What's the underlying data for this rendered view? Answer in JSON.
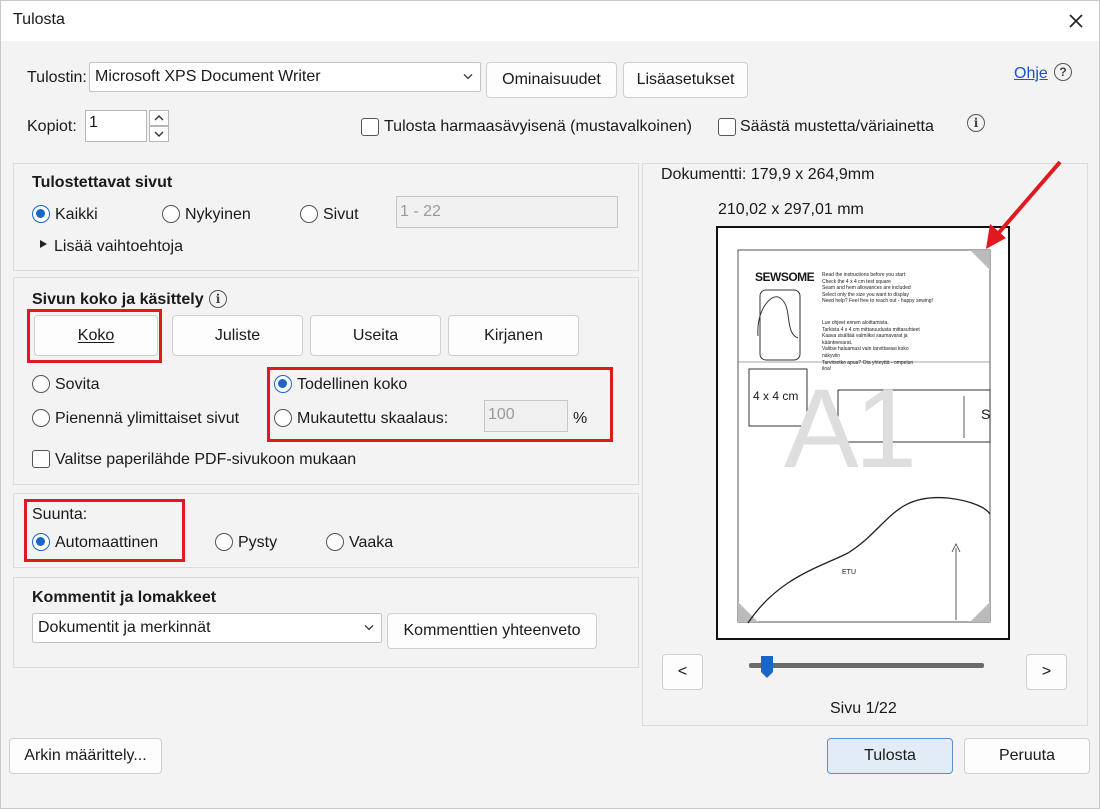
{
  "window": {
    "title": "Tulosta"
  },
  "printer": {
    "label": "Tulostin:",
    "selected": "Microsoft XPS Document Writer",
    "properties_button": "Ominaisuudet",
    "advanced_button": "Lisäasetukset",
    "help_link": "Ohje",
    "help_icon": "?"
  },
  "copies": {
    "label": "Kopiot:",
    "value": "1"
  },
  "options": {
    "grayscale": "Tulosta harmaasävyisenä (mustavalkoinen)",
    "save_ink": "Säästä mustetta/väriainetta"
  },
  "pages_section": {
    "title": "Tulostettavat sivut",
    "all": "Kaikki",
    "current": "Nykyinen",
    "pages": "Sivut",
    "range": "1 - 22",
    "more_options": "Lisää vaihtoehtoja"
  },
  "sizing_section": {
    "title": "Sivun koko ja käsittely",
    "tabs": [
      "Koko",
      "Juliste",
      "Useita",
      "Kirjanen"
    ],
    "fit": "Sovita",
    "actual_size": "Todellinen koko",
    "shrink": "Pienennä ylimittaiset sivut",
    "custom_scale": "Mukautettu skaalaus:",
    "scale_value": "100",
    "percent": "%",
    "paper_source": "Valitse paperilähde PDF-sivukoon mukaan"
  },
  "orientation": {
    "label": "Suunta:",
    "auto": "Automaattinen",
    "portrait": "Pysty",
    "landscape": "Vaaka"
  },
  "comments": {
    "title": "Kommentit ja lomakkeet",
    "selected": "Dokumentit ja merkinnät",
    "summary_button": "Kommenttien yhteenveto"
  },
  "preview": {
    "document_size": "Dokumentti: 179,9 x 264,9mm",
    "paper_size": "210,02 x 297,01 mm",
    "page_label": "Sivu 1/22",
    "prev": "<",
    "next": ">",
    "page_progress": 0.05,
    "content": {
      "brand": "SEWSOME",
      "instructions_en": [
        "Read the instructions before you start",
        "Check the 4 x 4 cm test square",
        "Seam and hem allowances are included",
        "Select only the size you want to display",
        "Need help? Feel free to reach out - happy sewing!"
      ],
      "instructions_fi": [
        "Lue ohjeet ennen aloittamista.",
        "Tarkista 4 x 4 cm mittaruudusta mittasuhteet",
        "Kaava sisältää valmiiksi saumavarat ja käänteevarat.",
        "Valitse haluamasi vain tarvittavasi koko näkyviin",
        "Tarvitsetko apua? Ota yhteyttä - ompelun iloa!"
      ],
      "test_square": "4 x 4 cm",
      "watermark": "A1",
      "piece_label": "ETU",
      "edge_letter": "S"
    }
  },
  "footer": {
    "page_setup": "Arkin määrittely...",
    "print": "Tulosta",
    "cancel": "Peruuta"
  },
  "colors": {
    "accent": "#1a65c8",
    "highlight": "#e0191f",
    "primary_button": "#e1ecf6"
  }
}
